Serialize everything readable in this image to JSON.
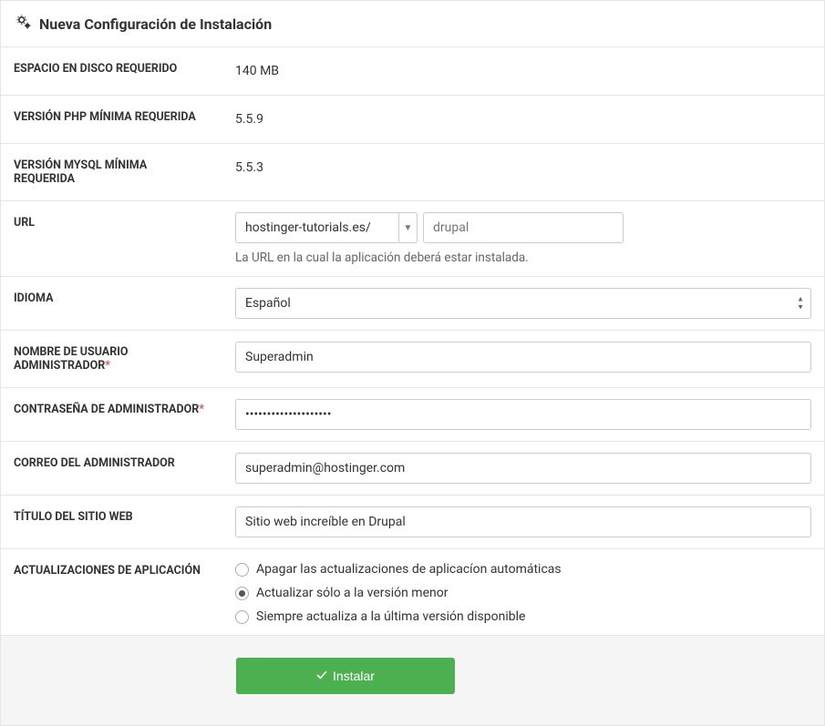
{
  "header": {
    "title": "Nueva Configuración de Instalación"
  },
  "rows": {
    "disk_label": "ESPACIO EN DISCO REQUERIDO",
    "disk_value": "140 MB",
    "php_label": "VERSIÓN PHP MÍNIMA REQUERIDA",
    "php_value": "5.5.9",
    "mysql_label": "VERSIÓN MYSQL MÍNIMA REQUERIDA",
    "mysql_value": "5.5.3",
    "url_label": "URL",
    "url_domain": "hostinger-tutorials.es/",
    "url_path_placeholder": "drupal",
    "url_hint": "La URL en la cual la aplicación deberá estar instalada.",
    "lang_label": "IDIOMA",
    "lang_value": "Español",
    "admin_user_label": "NOMBRE DE USUARIO ADMINISTRADOR",
    "admin_user_value": "Superadmin",
    "admin_pass_label": "CONTRASEÑA DE ADMINISTRADOR",
    "admin_pass_value": "••••••••••••••••••••",
    "admin_email_label": "CORREO DEL ADMINISTRADOR",
    "admin_email_value": "superadmin@hostinger.com",
    "title_label": "TÍTULO DEL SITIO WEB",
    "title_value": "Sitio web increíble en Drupal",
    "updates_label": "ACTUALIZACIONES DE APLICACIÓN",
    "updates_opt1": "Apagar las actualizaciones de aplicacíon automáticas",
    "updates_opt2": "Actualizar sólo a la versión menor",
    "updates_opt3": "Siempre actualiza a la última versión disponible"
  },
  "footer": {
    "install_label": "Instalar"
  }
}
